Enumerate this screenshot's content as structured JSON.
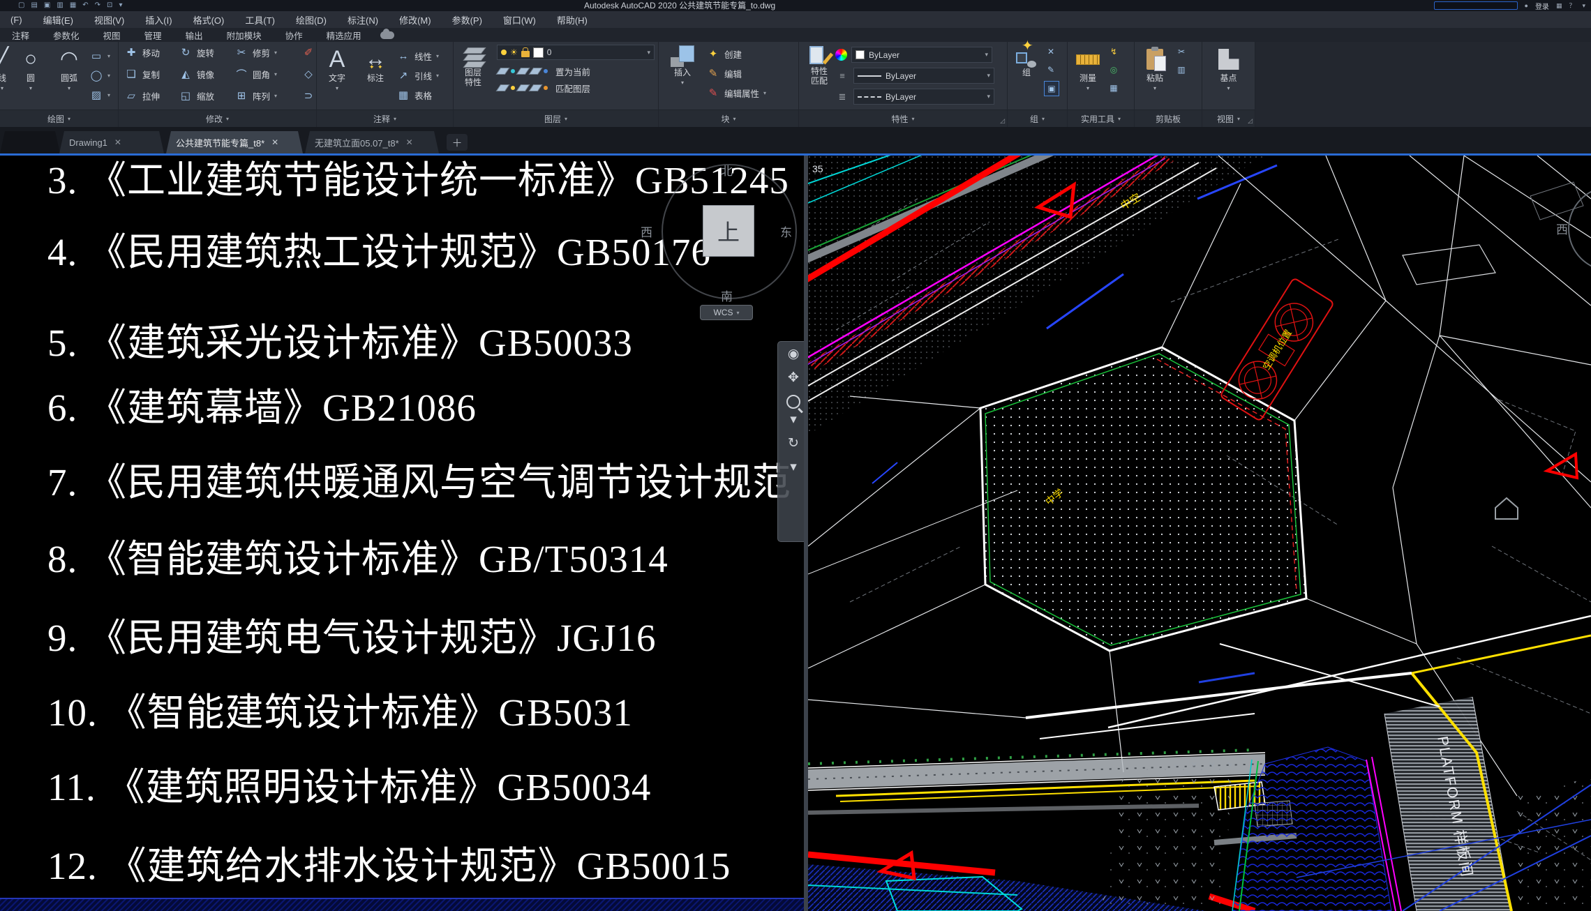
{
  "window": {
    "title": "Autodesk AutoCAD 2020  公共建筑节能专篇_to.dwg",
    "signin": "登录"
  },
  "menu_bar": {
    "items": [
      "(F)",
      "编辑(E)",
      "视图(V)",
      "插入(I)",
      "格式(O)",
      "工具(T)",
      "绘图(D)",
      "标注(N)",
      "修改(M)",
      "参数(P)",
      "窗口(W)",
      "帮助(H)"
    ]
  },
  "ribbon": {
    "tabs": [
      "注释",
      "参数化",
      "视图",
      "管理",
      "输出",
      "附加模块",
      "协作",
      "精选应用"
    ],
    "draw": {
      "title": "绘图",
      "line": "线",
      "circle": "圆",
      "arc": "圆弧"
    },
    "modify": {
      "title": "修改",
      "move": "移动",
      "rotate": "旋转",
      "trim": "修剪",
      "copy": "复制",
      "mirror": "镜像",
      "fillet": "圆角",
      "stretch": "拉伸",
      "scale": "缩放",
      "array": "阵列"
    },
    "annotate": {
      "title": "注释",
      "text": "文字",
      "dimension": "标注",
      "linear": "线性",
      "leader": "引线",
      "table": "表格"
    },
    "layers": {
      "title": "图层",
      "layer_properties": "图层特性",
      "current_layer": "0",
      "set_current": "置为当前",
      "match_layer": "匹配图层"
    },
    "block": {
      "title": "块",
      "insert": "插入",
      "create": "创建",
      "edit": "编辑",
      "edit_attributes": "编辑属性"
    },
    "properties": {
      "title": "特性",
      "match_props": "特性匹配",
      "color_value": "ByLayer",
      "lineweight_value": "ByLayer",
      "linetype_value": "ByLayer"
    },
    "groups": {
      "title": "组",
      "group": "组"
    },
    "utilities": {
      "title": "实用工具",
      "measure": "测量"
    },
    "clipboard": {
      "title": "剪贴板",
      "paste": "粘贴"
    },
    "view": {
      "title": "视图",
      "base": "基点"
    }
  },
  "icons": {
    "line": "╱",
    "circle": "○",
    "arc": "◠",
    "rect": "▭",
    "ellipse": "◯",
    "hatch": "▨",
    "move": "✚",
    "rotate": "↻",
    "trim": "✂",
    "erase": "✐",
    "copy": "❏",
    "mirror": "◭",
    "fillet": "⌒",
    "explode": "◇",
    "stretch": "▱",
    "scale": "◱",
    "array": "⊞",
    "join": "⊃",
    "text": "A",
    "dimension": "↔",
    "linear": "↔",
    "leader": "↗",
    "table": "▦",
    "create_block": "✦",
    "edit_block": "✎",
    "edit_attr": "✎",
    "ungroup": "✕",
    "group_edit": "✎",
    "group_sel": "▣",
    "quick_select": "↯",
    "calculator": "▦",
    "id_point": "◎",
    "cut": "✂",
    "copy_clip": "▥",
    "nav_wheel": "◉",
    "nav_pan": "✥",
    "nav_orbit": "↻",
    "undo": "↶",
    "redo": "↷"
  },
  "file_tabs": {
    "tabs": [
      {
        "label": "Drawing1",
        "active": false
      },
      {
        "label": "公共建筑节能专篇_t8*",
        "active": true
      },
      {
        "label": "无建筑立面05.07_t8*",
        "active": false
      }
    ]
  },
  "left_viewport": {
    "list_items": [
      "3. 《工业建筑节能设计统一标准》GB51245",
      "4. 《民用建筑热工设计规范》GB50176",
      "5. 《建筑采光设计标准》GB50033",
      "6. 《建筑幕墙》GB21086",
      "7. 《民用建筑供暖通风与空气调节设计规范",
      "8. 《智能建筑设计标准》GB/T50314",
      "9. 《民用建筑电气设计规范》JGJ16",
      "10. 《智能建筑设计标准》GB5031",
      "11. 《建筑照明设计标准》GB50034",
      "12. 《建筑给水排水设计规范》GB50015"
    ],
    "viewcube": {
      "top": "上",
      "north": "北",
      "south": "南",
      "east": "东",
      "west": "西"
    },
    "wcs": "WCS"
  },
  "right_viewport": {
    "labels": {
      "hollow": "中空",
      "school": "中学",
      "ac_block": "空调机位置",
      "platform": "PLATFORM 样板间",
      "west": "西",
      "fragment": "35"
    }
  },
  "colors": {
    "accent": "#2a6bd4",
    "cad_red": "#ff0000",
    "cad_magenta": "#ff00ff",
    "cad_yellow": "#ffe000",
    "cad_cyan": "#00d8d8",
    "cad_green": "#19c03a",
    "cad_blue": "#2040e0"
  }
}
